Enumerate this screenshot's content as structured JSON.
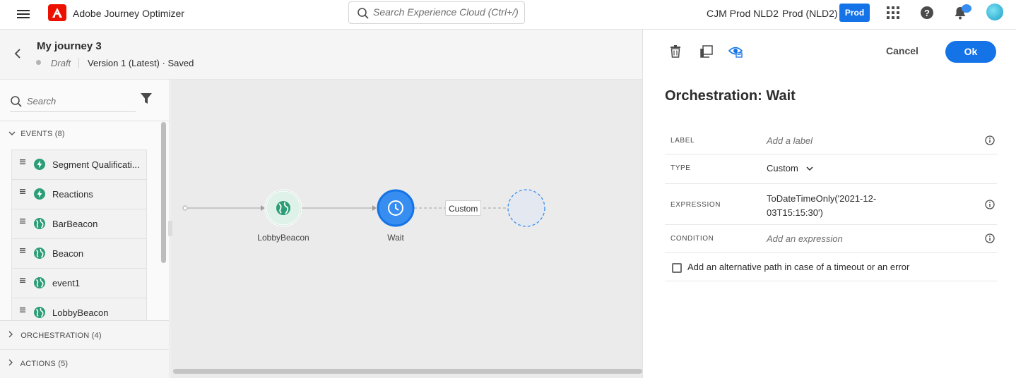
{
  "app": {
    "name": "Adobe Journey Optimizer",
    "search_placeholder": "Search Experience Cloud (Ctrl+/)",
    "org": "CJM Prod NLD2",
    "sandbox": "Prod (NLD2)",
    "sandbox_badge": "Prod"
  },
  "journey": {
    "title": "My journey 3",
    "status": "Draft",
    "version": "Version 1 (Latest) · Saved"
  },
  "palette": {
    "search_placeholder": "Search",
    "events_header": "EVENTS (8)",
    "events": [
      {
        "label": "Segment Qualificati...",
        "icon": "lightning-icon"
      },
      {
        "label": "Reactions",
        "icon": "lightning-icon"
      },
      {
        "label": "BarBeacon",
        "icon": "globe-icon"
      },
      {
        "label": "Beacon",
        "icon": "globe-icon"
      },
      {
        "label": "event1",
        "icon": "globe-icon"
      },
      {
        "label": "LobbyBeacon",
        "icon": "globe-icon"
      }
    ],
    "orchestration_header": "ORCHESTRATION (4)",
    "actions_header": "ACTIONS (5)"
  },
  "canvas": {
    "nodes": [
      {
        "label": "LobbyBeacon",
        "icon": "globe-icon"
      },
      {
        "label": "Wait",
        "icon": "clock-icon"
      }
    ],
    "edge_label": "Custom"
  },
  "panel": {
    "cancel_label": "Cancel",
    "ok_label": "Ok",
    "title": "Orchestration: Wait",
    "fields": {
      "label_key": "LABEL",
      "label_placeholder": "Add a label",
      "type_key": "TYPE",
      "type_value": "Custom",
      "expression_key": "EXPRESSION",
      "expression_line1": "ToDateTimeOnly('2021-12-",
      "expression_line2": "03T15:15:30')",
      "condition_key": "CONDITION",
      "condition_placeholder": "Add an expression"
    },
    "alt_path_label": "Add an alternative path in case of a timeout or an error"
  },
  "colors": {
    "accent": "#1473e6",
    "brand": "#eb1000",
    "event_green": "#2d9d78",
    "wait_blue": "#378ef0"
  }
}
